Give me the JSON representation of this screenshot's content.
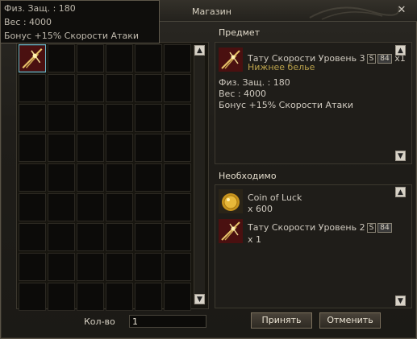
{
  "window": {
    "title": "Магазин",
    "close_glyph": "✕"
  },
  "tooltip": {
    "line1": "Физ. Защ. : 180",
    "line2": "Вес : 4000",
    "line3": "Бонус +15% Скорости Атаки"
  },
  "item_panel": {
    "header": "Предмет",
    "name": "Тату Скорости Уровень 3",
    "grade_badge": "S",
    "level_badge": "84",
    "count": "x1",
    "type": "Нижнее белье",
    "stats": [
      "Физ. Защ. : 180",
      "Вес : 4000",
      "Бонус +15% Скорости Атаки"
    ]
  },
  "required_panel": {
    "header": "Необходимо",
    "items": [
      {
        "name": "Coin of Luck",
        "qty": "x 600",
        "icon": "coin-icon"
      },
      {
        "name": "Тату Скорости Уровень 2",
        "grade_badge": "S",
        "level_badge": "84",
        "qty": "x 1",
        "icon": "tattoo-icon"
      }
    ]
  },
  "quantity": {
    "label": "Кол-во",
    "value": "1"
  },
  "buttons": {
    "accept": "Принять",
    "cancel": "Отменить"
  },
  "scroll": {
    "up": "▲",
    "down": "▼"
  },
  "colors": {
    "accent_yellow": "#bba24b",
    "selected_cell": "#6fb7c8"
  }
}
